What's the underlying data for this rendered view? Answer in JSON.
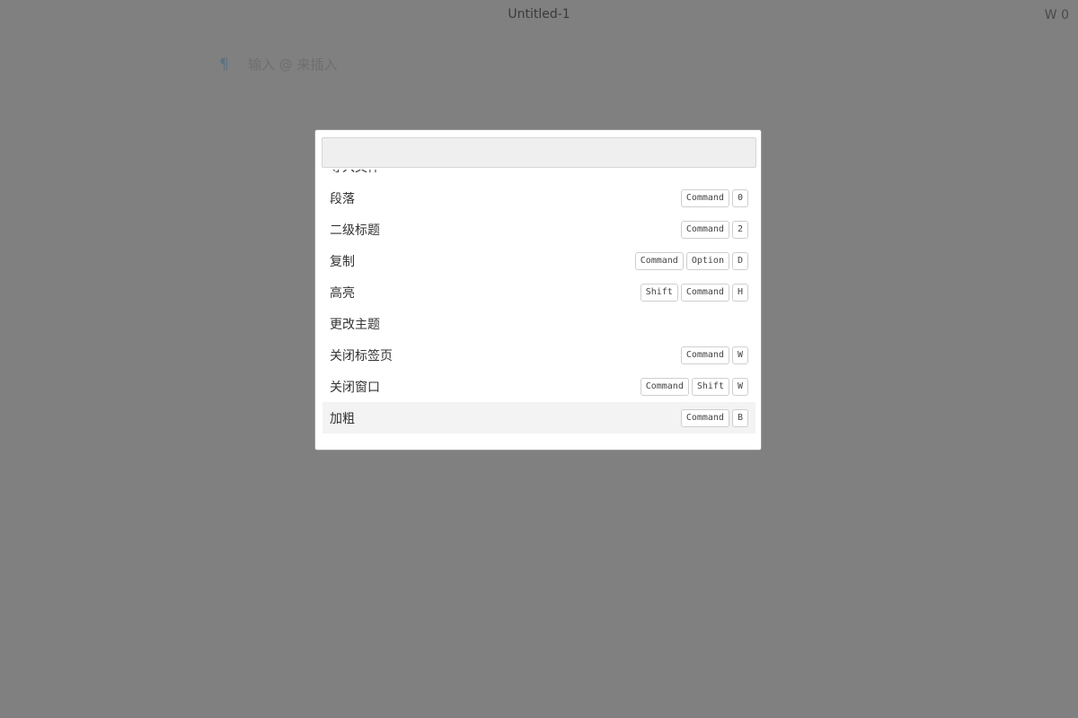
{
  "window": {
    "title": "Untitled-1",
    "word_count": "W 0"
  },
  "editor": {
    "pilcrow": "¶",
    "placeholder": "输入 @ 来插入"
  },
  "palette": {
    "search_value": "",
    "items": [
      {
        "label": "导入文件",
        "keys": []
      },
      {
        "label": "段落",
        "keys": [
          "Command",
          "0"
        ]
      },
      {
        "label": "二级标题",
        "keys": [
          "Command",
          "2"
        ]
      },
      {
        "label": "复制",
        "keys": [
          "Command",
          "Option",
          "D"
        ]
      },
      {
        "label": "高亮",
        "keys": [
          "Shift",
          "Command",
          "H"
        ]
      },
      {
        "label": "更改主题",
        "keys": []
      },
      {
        "label": "关闭标签页",
        "keys": [
          "Command",
          "W"
        ]
      },
      {
        "label": "关闭窗口",
        "keys": [
          "Command",
          "Shift",
          "W"
        ]
      },
      {
        "label": "加粗",
        "keys": [
          "Command",
          "B"
        ]
      }
    ],
    "selected_index": 8
  },
  "colors": {
    "overlay": "#808080",
    "palette_bg": "#ffffff",
    "selected_row": "#f3f3f3"
  }
}
